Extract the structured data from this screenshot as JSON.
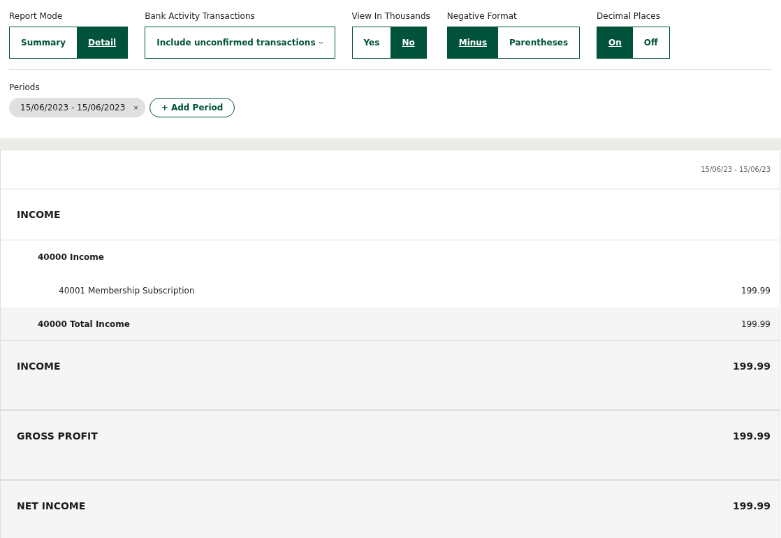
{
  "filters": [
    {
      "kind": "toggle",
      "label": "Report Mode",
      "options": [
        {
          "label": "Summary",
          "selected": false
        },
        {
          "label": "Detail",
          "selected": true
        }
      ]
    },
    {
      "kind": "dropdown",
      "label": "Bank Activity Transactions",
      "value": "Include unconfirmed transactions"
    },
    {
      "kind": "toggle",
      "label": "View In Thousands",
      "options": [
        {
          "label": "Yes",
          "selected": false
        },
        {
          "label": "No",
          "selected": true
        }
      ]
    },
    {
      "kind": "toggle",
      "label": "Negative Format",
      "options": [
        {
          "label": "Minus",
          "selected": true
        },
        {
          "label": "Parentheses",
          "selected": false
        }
      ]
    },
    {
      "kind": "toggle",
      "label": "Decimal Places",
      "options": [
        {
          "label": "On",
          "selected": true
        },
        {
          "label": "Off",
          "selected": false
        }
      ]
    }
  ],
  "periods": {
    "label": "Periods",
    "chips": [
      "15/06/2023 - 15/06/2023"
    ],
    "remove": "×",
    "add_button": "+ Add Period"
  },
  "report": {
    "column_header": "15/06/23 - 15/06/23",
    "rows": [
      {
        "kind": "section",
        "label": "INCOME"
      },
      {
        "kind": "group",
        "label": "40000 Income"
      },
      {
        "kind": "line",
        "label": "40001 Membership Subscription",
        "value": "199.99"
      },
      {
        "kind": "subtotal",
        "label": "40000 Total Income",
        "value": "199.99"
      },
      {
        "kind": "total",
        "label": "INCOME",
        "value": "199.99"
      },
      {
        "kind": "total",
        "label": "GROSS PROFIT",
        "value": "199.99"
      },
      {
        "kind": "total",
        "label": "NET INCOME",
        "value": "199.99"
      }
    ]
  }
}
